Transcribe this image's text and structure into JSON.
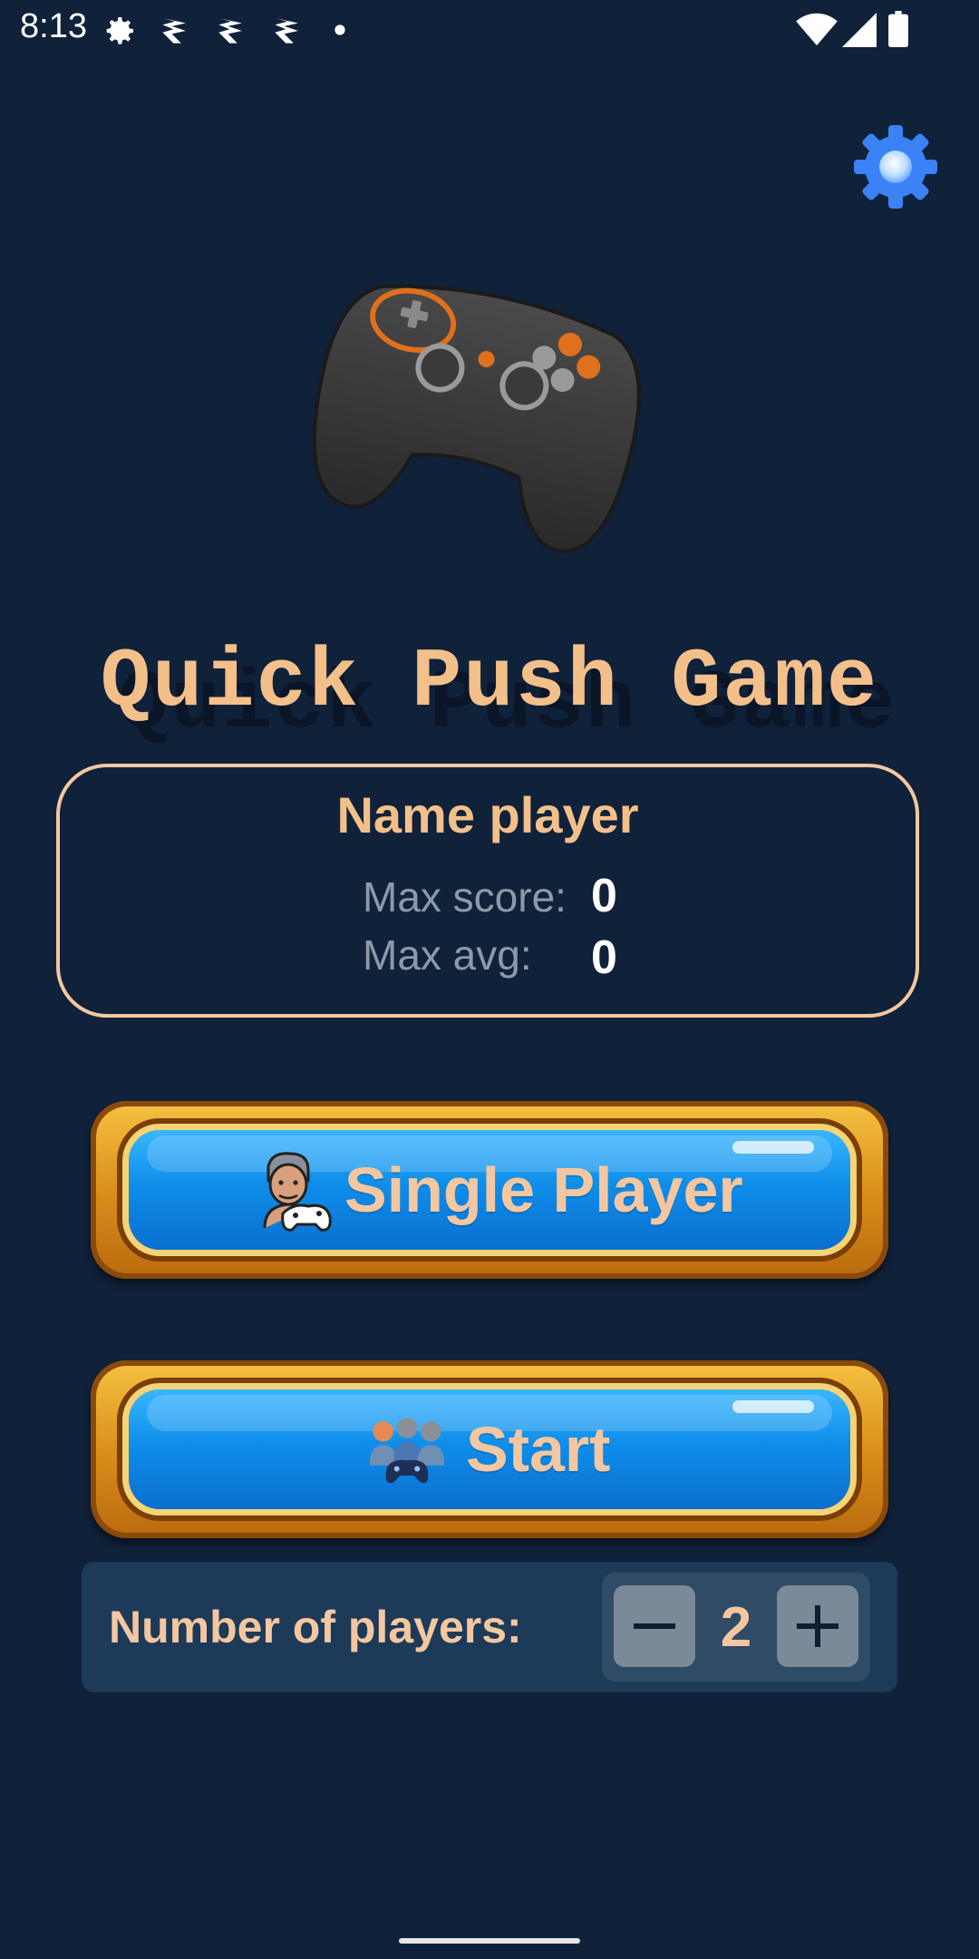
{
  "status_bar": {
    "time": "8:13",
    "left_icons": [
      "gear-icon",
      "notification-icon",
      "notification-icon",
      "notification-icon",
      "dot-icon"
    ],
    "right_icons": [
      "wifi-icon",
      "signal-icon",
      "battery-icon"
    ]
  },
  "header": {
    "settings_icon": "gear-icon",
    "settings_color": "#3b82f6"
  },
  "hero": {
    "image": "game-controller-icon",
    "title": "Quick Push Game"
  },
  "player_card": {
    "name": "Name player",
    "max_score_label": "Max score:",
    "max_score_value": "0",
    "max_avg_label": "Max avg:",
    "max_avg_value": "0"
  },
  "buttons": {
    "single_player": {
      "label": "Single Player",
      "icon": "player-with-controller-icon"
    },
    "start": {
      "label": "Start",
      "icon": "group-players-icon"
    }
  },
  "players": {
    "label": "Number of players:",
    "value": "2",
    "decrement_icon": "minus-icon",
    "increment_icon": "plus-icon"
  },
  "colors": {
    "background": "#10213a",
    "accent_text": "#f4c08a",
    "button_blue": "#0f8eea",
    "button_gold": "#d98b19"
  }
}
